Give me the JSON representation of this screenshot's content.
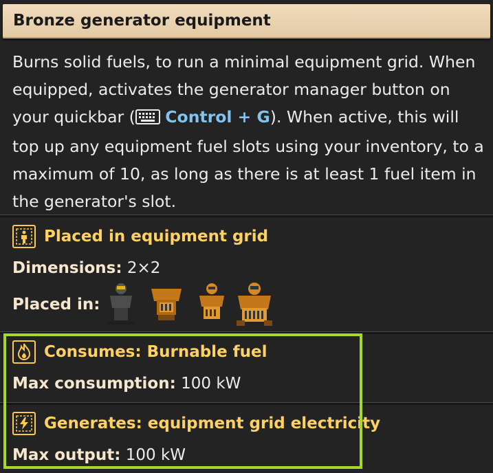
{
  "tooltip": {
    "title": "Bronze generator equipment",
    "description_parts": {
      "before": "Burns solid fuels, to run a minimal equipment grid. When equipped, activates the generator manager button on your quickbar (",
      "keybind": "Control + G",
      "after": "). When active, this will top up any equipment fuel slots using your inventory, to a maximum of 10, as long as there is at least 1 fuel item in the generator's slot."
    },
    "keyboard_icon": "keyboard-icon"
  },
  "placement": {
    "heading": "Placed in equipment grid",
    "icon": "equipment-grid-icon",
    "dimensions_label": "Dimensions:",
    "dimensions_value": "2×2",
    "placed_in_label": "Placed in:",
    "armors": [
      "light-armor-icon",
      "heavy-armor-icon",
      "modular-armor-icon",
      "power-armor-icon"
    ]
  },
  "consumes": {
    "heading": "Consumes: Burnable fuel",
    "icon": "flame-icon",
    "max_label": "Max consumption:",
    "max_value": "100 kW"
  },
  "generates": {
    "heading": "Generates: equipment grid electricity",
    "icon": "electricity-icon",
    "max_label": "Max output:",
    "max_value": "100 kW"
  },
  "colors": {
    "heading": "#ffd164",
    "keybind": "#7fc3ee",
    "highlight": "#a6d72a",
    "titlebar": "#e8d0ab"
  }
}
